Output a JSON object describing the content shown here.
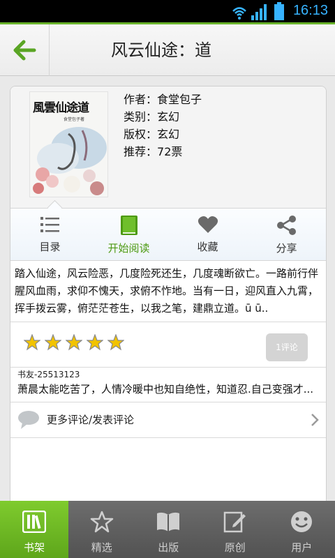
{
  "status_bar": {
    "time": "16:13"
  },
  "header": {
    "title": "风云仙途：道"
  },
  "book": {
    "cover_title": "風雲仙途道",
    "cover_subtitle": "食堂包子著",
    "meta": [
      {
        "key": "作者：",
        "value": "食堂包子"
      },
      {
        "key": "类别：",
        "value": "玄幻"
      },
      {
        "key": "版权：",
        "value": "玄幻"
      },
      {
        "key": "推荐：",
        "value": "72票"
      }
    ]
  },
  "actions": [
    {
      "label": "目录",
      "icon": "list-icon"
    },
    {
      "label": "开始阅读",
      "icon": "book-icon"
    },
    {
      "label": "收藏",
      "icon": "heart-icon"
    },
    {
      "label": "分享",
      "icon": "share-icon"
    }
  ],
  "description": "踏入仙途，风云险恶，几度险死还生，几度魂断欲亡。一路前行伴腥风血雨，求仰不愧天，求俯不怍地。当有一日，迎风直入九霄，挥手拨云雾，俯茫茫苍生，以我之笔，建鼎立道。ū ū..",
  "rating": {
    "stars": 5,
    "comment_button": "1评论"
  },
  "comment": {
    "user": "书友-25513123",
    "text": "萧晨太能吃苦了，人情冷暖中也知自绝性，知道忍.自己变强才..."
  },
  "more_comments": "更多评论/发表评论",
  "accent_color": "#6ab42b",
  "nav": [
    {
      "label": "书架",
      "icon": "bookshelf-icon"
    },
    {
      "label": "精选",
      "icon": "star-icon"
    },
    {
      "label": "出版",
      "icon": "open-book-icon"
    },
    {
      "label": "原创",
      "icon": "edit-icon"
    },
    {
      "label": "用户",
      "icon": "smiley-icon"
    }
  ]
}
